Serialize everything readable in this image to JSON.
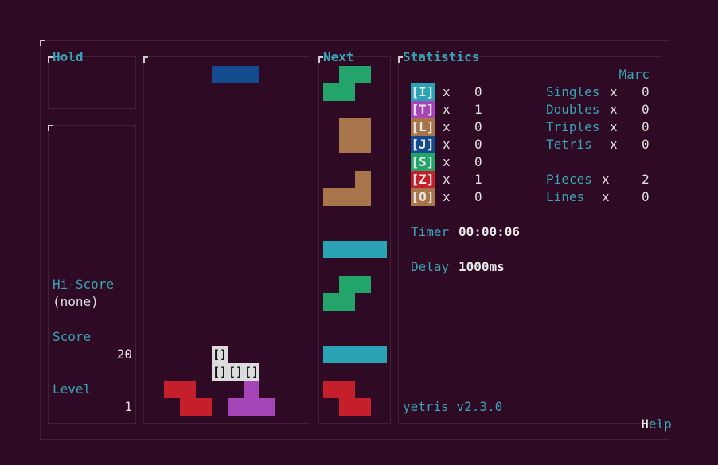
{
  "hold": {
    "title": "Hold"
  },
  "info": {
    "hiscore_label": "Hi-Score",
    "hiscore_value": "(none)",
    "score_label": "Score",
    "score_value": "20",
    "level_label": "Level",
    "level_value": "1"
  },
  "next": {
    "title": "Next"
  },
  "stats": {
    "title": "Statistics",
    "player": "Marc",
    "pieces": [
      {
        "tag": "[I]",
        "count": "0",
        "color": "#2aa3b5"
      },
      {
        "tag": "[T]",
        "count": "1",
        "color": "#a645b8"
      },
      {
        "tag": "[L]",
        "count": "0",
        "color": "#a8744a"
      },
      {
        "tag": "[J]",
        "count": "0",
        "color": "#134b8e"
      },
      {
        "tag": "[S]",
        "count": "0",
        "color": "#23a46a"
      },
      {
        "tag": "[Z]",
        "count": "1",
        "color": "#c51f2c"
      },
      {
        "tag": "[O]",
        "count": "0",
        "color": "#a8744a"
      }
    ],
    "x": "x",
    "lines_stats": [
      {
        "label": "Singles",
        "value": "0"
      },
      {
        "label": "Doubles",
        "value": "0"
      },
      {
        "label": "Triples",
        "value": "0"
      },
      {
        "label": "Tetris",
        "value": "0"
      }
    ],
    "pieces_label": "Pieces",
    "pieces_value": "2",
    "lines_label": "Lines",
    "lines_value": "0",
    "timer_label": "Timer",
    "timer_value": "00:00:06",
    "delay_label": "Delay",
    "delay_value": "1000ms",
    "version": "yetris v2.3.0",
    "help_h": "H",
    "help_rest": "elp"
  },
  "board": {
    "ghost_glyph": "[]"
  },
  "colors": {
    "background": "#2f0a24",
    "accent": "#3aa3b5",
    "I": "#2aa3b5",
    "T": "#a645b8",
    "L": "#a8744a",
    "J": "#134b8e",
    "S": "#23a46a",
    "Z": "#c51f2c"
  }
}
